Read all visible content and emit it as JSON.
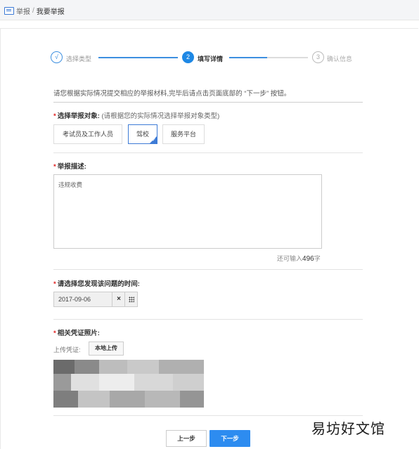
{
  "breadcrumb": {
    "icon": "list-icon",
    "parent": "举报",
    "separator": "/",
    "current": "我要举报"
  },
  "steps": [
    {
      "label": "选择类型",
      "badge": "√",
      "state": "done"
    },
    {
      "label": "填写详情",
      "badge": "2",
      "state": "active"
    },
    {
      "label": "确认信息",
      "badge": "3",
      "state": "pending"
    }
  ],
  "notice": "请您根据实际情况提交相应的举报材料,完毕后请点击页面底部的 “下一步” 按钮。",
  "target": {
    "label": "选择举报对象:",
    "hint": "(请根据您的实际情况选择举报对象类型)",
    "options": [
      "考试员及工作人员",
      "驾校",
      "服务平台"
    ],
    "selected": "驾校"
  },
  "description": {
    "label": "举报描述:",
    "value": "违规收费",
    "remaining_prefix": "还可输入",
    "remaining_count": "496",
    "remaining_suffix": "字"
  },
  "date": {
    "label": "请选择您发现该问题的时间:",
    "value": "2017-09-06",
    "clear_icon": "close-icon",
    "calendar_icon": "calendar-icon"
  },
  "photo": {
    "label": "相关凭证照片:",
    "upload_label": "上传凭证:",
    "upload_button": "本地上传"
  },
  "actions": {
    "prev": "上一步",
    "next": "下一步"
  },
  "watermark": "易坊好文馆",
  "colors": {
    "accent": "#2d8cf0",
    "step_active": "#1e88e5",
    "required": "#e02020"
  }
}
